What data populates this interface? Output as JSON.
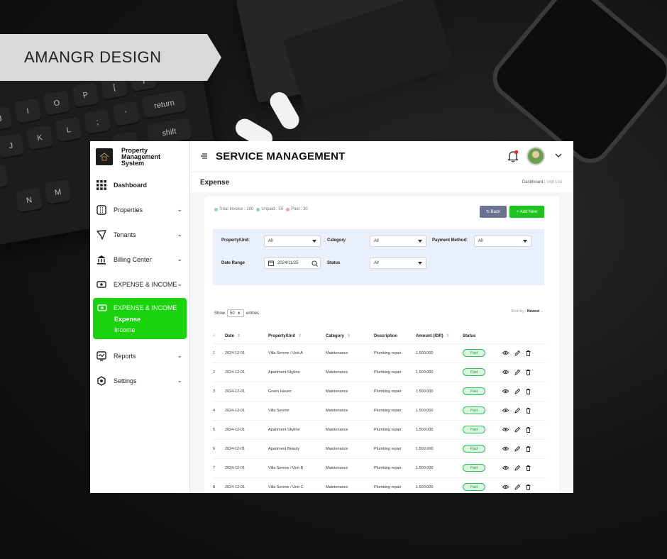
{
  "banner": {
    "text": "AMANGR DESIGN"
  },
  "background": {
    "keys": [
      "U",
      "I",
      "O",
      "P",
      "[",
      "]",
      "J",
      "K",
      "L",
      ";",
      "'",
      "return",
      "H",
      "N",
      "M",
      "?",
      "shift"
    ]
  },
  "brand": {
    "line1": "Property",
    "line2": "Management",
    "line3": "System",
    "logo_icon": "house-logo-icon"
  },
  "sidebar": {
    "items": [
      {
        "label": "Dashboard",
        "icon": "grid-icon",
        "chevron": false
      },
      {
        "label": "Properties",
        "icon": "building-icon",
        "chevron": true
      },
      {
        "label": "Tenants",
        "icon": "send-icon",
        "chevron": true
      },
      {
        "label": "Billing Center",
        "icon": "bank-icon",
        "chevron": true
      },
      {
        "label": "EXPENSE & INCOME",
        "icon": "money-icon",
        "chevron": true
      }
    ],
    "active": {
      "label": "EXPENSE & INCOME",
      "sub1": "Expense",
      "sub2": "Income"
    },
    "lower": [
      {
        "label": "Reports",
        "icon": "chart-icon"
      },
      {
        "label": "Settings",
        "icon": "gear-icon"
      }
    ]
  },
  "header": {
    "title": "SERVICE MANAGEMENT"
  },
  "subheader": {
    "page": "Expense",
    "crumb1": "Dashboard",
    "sep": "|",
    "crumb2": "Unit List"
  },
  "stats": {
    "total": "Total Invoice : 100",
    "unpaid": "Unpaid : 50",
    "paid": "Paid : 30"
  },
  "buttons": {
    "back": "↻ Back",
    "add": "+ Add New"
  },
  "filters": {
    "property_label": "Property/Unit:",
    "property_value": "All",
    "category_label": "Category",
    "category_value": "All",
    "payment_label": "Payment Method:",
    "payment_value": "All",
    "date_label": "Date Range",
    "date_value": "2024/11/25",
    "status_label": "Status",
    "status_value": "All"
  },
  "list_controls": {
    "show": "Show",
    "entries_value": "50",
    "entries": "entries",
    "sort_label": "Short by :",
    "sort_value": "Newest"
  },
  "table": {
    "headers": [
      "#",
      "Date",
      "Property/Unit",
      "Category",
      "Description",
      "Amount (IDR)",
      "Status"
    ],
    "rows": [
      {
        "no": "1",
        "date": "2024-12-01",
        "unit": "Villa Serene / Unit A",
        "category": "Maintenance",
        "desc": "Plumbing repair",
        "amount": "1.500.000",
        "status": "Paid"
      },
      {
        "no": "2",
        "date": "2024-12-01",
        "unit": "Apartment Skyline",
        "category": "Maintenance",
        "desc": "Plumbing repair",
        "amount": "1.500.000",
        "status": "Paid"
      },
      {
        "no": "3",
        "date": "2024-12-01",
        "unit": "Green Haven",
        "category": "Maintenance",
        "desc": "Plumbing repair",
        "amount": "1.500.000",
        "status": "Paid"
      },
      {
        "no": "4",
        "date": "2024-12-01",
        "unit": "Villa Serene",
        "category": "Maintenance",
        "desc": "Plumbing repair",
        "amount": "1.500.000",
        "status": "Paid"
      },
      {
        "no": "5",
        "date": "2024-12-01",
        "unit": "Apartment Skyline",
        "category": "Maintenance",
        "desc": "Plumbing repair",
        "amount": "1.500.000",
        "status": "Paid"
      },
      {
        "no": "6",
        "date": "2024-12-01",
        "unit": "Apartment Beauty",
        "category": "Maintenance",
        "desc": "Plumbing repair",
        "amount": "1.500.000",
        "status": "Paid"
      },
      {
        "no": "7",
        "date": "2024-12-01",
        "unit": "Villa Serene / Unit B",
        "category": "Maintenance",
        "desc": "Plumbing repair",
        "amount": "1.500.000",
        "status": "Paid"
      },
      {
        "no": "8",
        "date": "2024-12-01",
        "unit": "Villa Serene / Unit C",
        "category": "Maintenance",
        "desc": "Plumbing repair",
        "amount": "1.500.000",
        "status": "Paid"
      }
    ]
  },
  "colors": {
    "active_green": "#19d40d",
    "paid_green": "#2fbf5a",
    "back_btn": "#6b7390",
    "filter_bg": "#e9f0fb"
  }
}
